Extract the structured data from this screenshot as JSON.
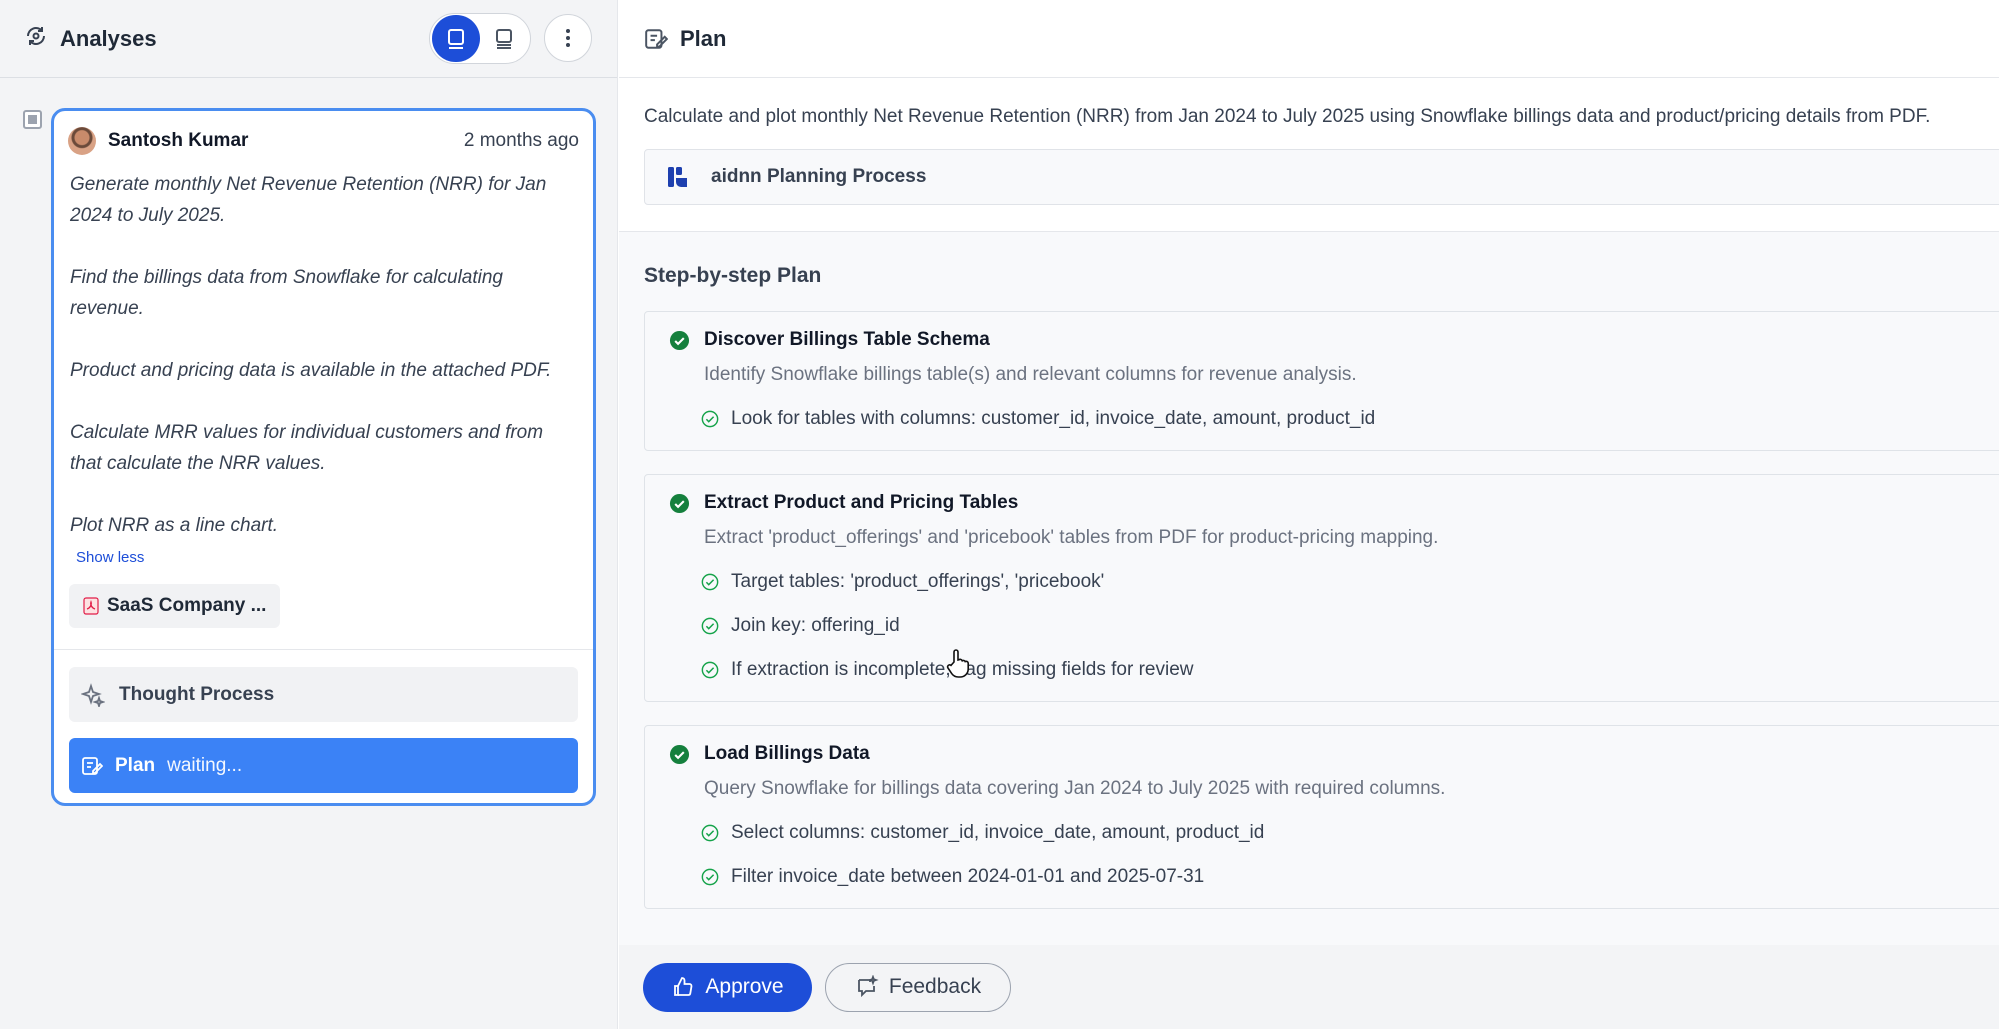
{
  "left": {
    "title": "Analyses",
    "card": {
      "user": "Santosh Kumar",
      "time": "2 months ago",
      "prompt": [
        "Generate monthly Net Revenue Retention (NRR) for Jan 2024 to July 2025.",
        "Find the billings data from Snowflake for calculating revenue.",
        "Product and pricing data is available in the attached PDF.",
        "Calculate MRR values for individual customers and from that calculate the NRR values.",
        "Plot NRR as a line chart."
      ],
      "show_less": "Show less",
      "attachment": "SaaS Company ...",
      "thought_process": "Thought Process",
      "plan_label": "Plan",
      "plan_status": "waiting..."
    }
  },
  "right": {
    "title": "Plan",
    "description": "Calculate and plot monthly Net Revenue Retention (NRR) from Jan 2024 to July 2025 using Snowflake billings data and product/pricing details from PDF.",
    "process_label": "aidnn Planning Process",
    "steps_title": "Step-by-step Plan",
    "steps": [
      {
        "title": "Discover Billings Table Schema",
        "desc": "Identify Snowflake billings table(s) and relevant columns for revenue analysis.",
        "items": [
          "Look for tables with columns: customer_id, invoice_date, amount, product_id"
        ]
      },
      {
        "title": "Extract Product and Pricing Tables",
        "desc": "Extract 'product_offerings' and 'pricebook' tables from PDF for product-pricing mapping.",
        "items": [
          "Target tables: 'product_offerings', 'pricebook'",
          "Join key: offering_id",
          "If extraction is incomplete, flag missing fields for review"
        ]
      },
      {
        "title": "Load Billings Data",
        "desc": "Query Snowflake for billings data covering Jan 2024 to July 2025 with required columns.",
        "items": [
          "Select columns: customer_id, invoice_date, amount, product_id",
          "Filter invoice_date between 2024-01-01 and 2025-07-31"
        ]
      }
    ],
    "approve": "Approve",
    "feedback": "Feedback"
  },
  "colors": {
    "primary": "#1d4ed8",
    "accent": "#3b82f6",
    "success": "#15803d",
    "card_border": "#4a8df0"
  }
}
